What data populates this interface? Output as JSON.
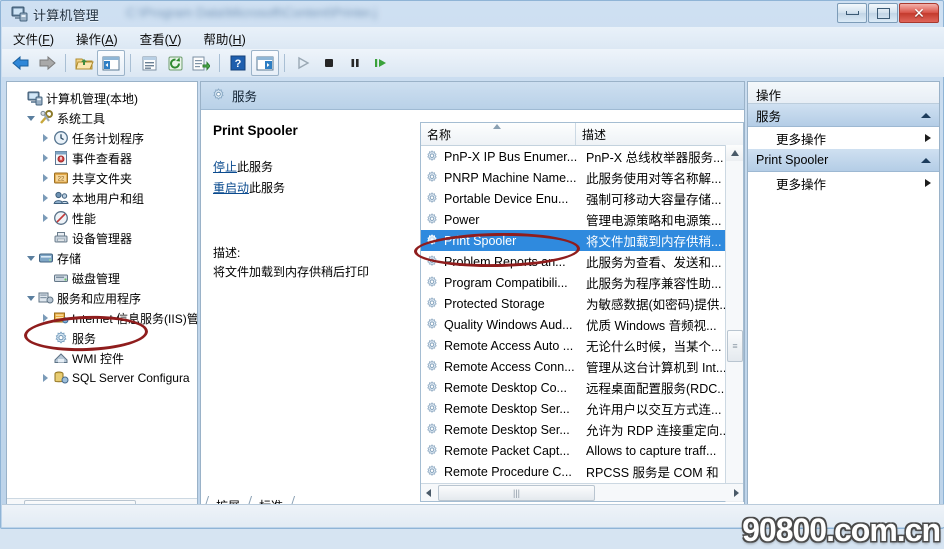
{
  "window": {
    "title": "计算机管理",
    "blurred_path": "C:\\Program Data\\Microsoft\\Content\\Printer.j",
    "icon": "computer-management-icon",
    "controls": {
      "minimize": "最小化",
      "maximize": "最大化",
      "close": "关闭"
    }
  },
  "menubar": [
    {
      "label": "文件",
      "accel": "F"
    },
    {
      "label": "操作",
      "accel": "A"
    },
    {
      "label": "查看",
      "accel": "V"
    },
    {
      "label": "帮助",
      "accel": "H"
    }
  ],
  "toolbar": [
    {
      "name": "back-arrow-icon",
      "label": "后退",
      "enabled": true
    },
    {
      "name": "forward-arrow-icon",
      "label": "前进",
      "enabled": false
    },
    {
      "name": "up-folder-icon",
      "label": "上移一级",
      "enabled": true
    },
    {
      "name": "show-tree-icon",
      "label": "显示/隐藏控制台树",
      "enabled": true
    },
    {
      "name": "properties-icon",
      "label": "属性",
      "enabled": true
    },
    {
      "name": "refresh-icon",
      "label": "刷新",
      "enabled": true
    },
    {
      "name": "export-list-icon",
      "label": "导出列表",
      "enabled": true
    },
    {
      "name": "help-icon",
      "label": "帮助",
      "enabled": true
    },
    {
      "name": "show-action-pane-icon",
      "label": "显示/隐藏操作窗格",
      "enabled": true
    },
    {
      "name": "start-service-icon",
      "label": "启动服务",
      "enabled": false
    },
    {
      "name": "stop-service-icon",
      "label": "停止服务",
      "enabled": true
    },
    {
      "name": "pause-service-icon",
      "label": "暂停服务",
      "enabled": true
    },
    {
      "name": "restart-service-icon",
      "label": "重启动服务",
      "enabled": true
    }
  ],
  "tree": {
    "root": {
      "label": "计算机管理(本地)",
      "icon": "computer-icon",
      "level": 0,
      "expander": "none"
    },
    "items": [
      {
        "label": "系统工具",
        "icon": "system-tools-icon",
        "level": 1,
        "expander": "down"
      },
      {
        "label": "任务计划程序",
        "icon": "clock-icon",
        "level": 2,
        "expander": "right"
      },
      {
        "label": "事件查看器",
        "icon": "event-viewer-icon",
        "level": 2,
        "expander": "right"
      },
      {
        "label": "共享文件夹",
        "icon": "shared-folder-icon",
        "level": 2,
        "expander": "right"
      },
      {
        "label": "本地用户和组",
        "icon": "users-icon",
        "level": 2,
        "expander": "right"
      },
      {
        "label": "性能",
        "icon": "performance-icon",
        "level": 2,
        "expander": "right"
      },
      {
        "label": "设备管理器",
        "icon": "device-manager-icon",
        "level": 2,
        "expander": "none"
      },
      {
        "label": "存储",
        "icon": "storage-icon",
        "level": 1,
        "expander": "down"
      },
      {
        "label": "磁盘管理",
        "icon": "disk-management-icon",
        "level": 2,
        "expander": "none"
      },
      {
        "label": "服务和应用程序",
        "icon": "services-apps-icon",
        "level": 1,
        "expander": "down"
      },
      {
        "label": "Internet 信息服务(IIS)管",
        "icon": "iis-icon",
        "level": 2,
        "expander": "right"
      },
      {
        "label": "服务",
        "icon": "gear-icon",
        "level": 2,
        "expander": "none",
        "annotated": true
      },
      {
        "label": "WMI 控件",
        "icon": "wmi-icon",
        "level": 2,
        "expander": "none"
      },
      {
        "label": "SQL Server Configura",
        "icon": "sql-server-icon",
        "level": 2,
        "expander": "right"
      }
    ],
    "hscroll": {
      "left_arrow": "◀",
      "right_arrow": "▶"
    }
  },
  "mid": {
    "header": {
      "icon": "gear-icon",
      "title": "服务"
    },
    "detail": {
      "service_name": "Print Spooler",
      "stop_link_underlined": "停止",
      "stop_link_rest": "此服务",
      "restart_link_underlined": "重启动",
      "restart_link_rest": "此服务",
      "desc_label": "描述:",
      "desc_text": "将文件加载到内存供稍后打印"
    },
    "list": {
      "columns": [
        {
          "label": "名称",
          "sorted": "asc"
        },
        {
          "label": "描述"
        }
      ],
      "rows": [
        {
          "name": "PnP-X IP Bus Enumer...",
          "desc": "PnP-X 总线枚举器服务...",
          "selected": false
        },
        {
          "name": "PNRP Machine Name...",
          "desc": "此服务使用对等名称解...",
          "selected": false
        },
        {
          "name": "Portable Device Enu...",
          "desc": "强制可移动大容量存储...",
          "selected": false
        },
        {
          "name": "Power",
          "desc": "管理电源策略和电源策...",
          "selected": false
        },
        {
          "name": "Print Spooler",
          "desc": "将文件加载到内存供稍...",
          "selected": true
        },
        {
          "name": "Problem Reports an...",
          "desc": "此服务为查看、发送和...",
          "selected": false
        },
        {
          "name": "Program Compatibili...",
          "desc": "此服务为程序兼容性助...",
          "selected": false
        },
        {
          "name": "Protected Storage",
          "desc": "为敏感数据(如密码)提供...",
          "selected": false
        },
        {
          "name": "Quality Windows Aud...",
          "desc": "优质 Windows 音频视...",
          "selected": false
        },
        {
          "name": "Remote Access Auto ...",
          "desc": "无论什么时候，当某个...",
          "selected": false
        },
        {
          "name": "Remote Access Conn...",
          "desc": "管理从这台计算机到 Int...",
          "selected": false
        },
        {
          "name": "Remote Desktop Co...",
          "desc": "远程桌面配置服务(RDC...",
          "selected": false
        },
        {
          "name": "Remote Desktop Ser...",
          "desc": "允许用户以交互方式连...",
          "selected": false
        },
        {
          "name": "Remote Desktop Ser...",
          "desc": "允许为 RDP 连接重定向...",
          "selected": false
        },
        {
          "name": "Remote Packet Capt...",
          "desc": "Allows to capture traff...",
          "selected": false
        },
        {
          "name": "Remote Procedure C...",
          "desc": "RPCSS 服务是 COM 和",
          "selected": false
        }
      ]
    },
    "tabs": [
      {
        "label": "扩展",
        "active": false
      },
      {
        "label": "标准",
        "active": true
      }
    ]
  },
  "actions": {
    "title": "操作",
    "groups": [
      {
        "header": "服务",
        "items": [
          {
            "label": "更多操作",
            "submenu": true
          }
        ]
      },
      {
        "header": "Print Spooler",
        "items": [
          {
            "label": "更多操作",
            "submenu": true
          }
        ]
      }
    ]
  },
  "watermark": "90800.com.cn",
  "colors": {
    "selection_blue": "#2f8ade",
    "annotation_red": "#8f1d1d",
    "title_gradient_top": "#cfe0f2",
    "group_header_blue": "#b4cde6"
  }
}
